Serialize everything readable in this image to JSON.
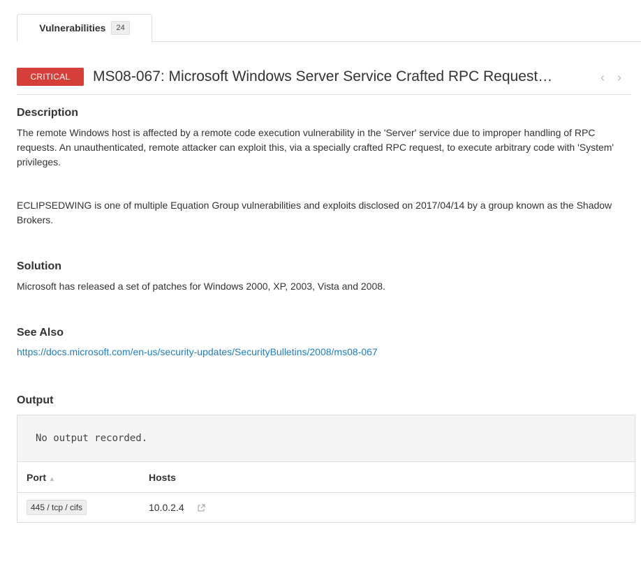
{
  "tabs": [
    {
      "label": "Vulnerabilities",
      "count": "24"
    }
  ],
  "vulnerability": {
    "severity": "CRITICAL",
    "severity_color": "#d43f3a",
    "title": "MS08-067: Microsoft Windows Server Service Crafted RPC Request…",
    "nav_prev": "‹",
    "nav_next": "›"
  },
  "description": {
    "heading": "Description",
    "paragraph1": "The remote Windows host is affected by a remote code execution vulnerability in the 'Server' service due to improper handling of RPC requests. An unauthenticated, remote attacker can exploit this, via a specially crafted RPC request, to execute arbitrary code with 'System' privileges.",
    "paragraph2": "ECLIPSEDWING is one of multiple Equation Group vulnerabilities and exploits disclosed on 2017/04/14 by a group known as the Shadow Brokers."
  },
  "solution": {
    "heading": "Solution",
    "text": "Microsoft has released a set of patches for Windows 2000, XP, 2003, Vista and 2008."
  },
  "see_also": {
    "heading": "See Also",
    "link": "https://docs.microsoft.com/en-us/security-updates/SecurityBulletins/2008/ms08-067"
  },
  "output": {
    "heading": "Output",
    "text": "No output recorded.",
    "columns": {
      "port": "Port",
      "port_sort_icon": "▲",
      "hosts": "Hosts"
    },
    "rows": [
      {
        "port": "445 / tcp / cifs",
        "host": "10.0.2.4"
      }
    ]
  },
  "colors": {
    "link": "#1f7fc1",
    "critical": "#d43f3a"
  }
}
